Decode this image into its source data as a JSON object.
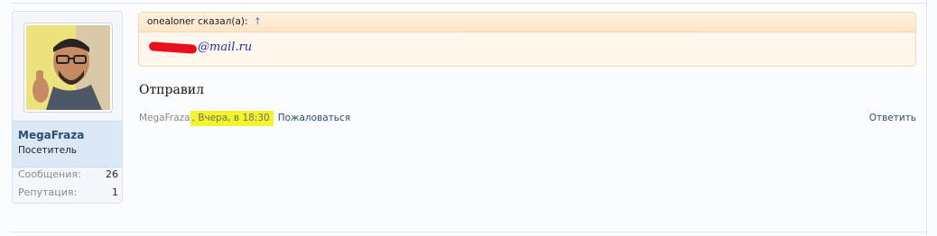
{
  "user": {
    "name": "MegaFraza",
    "title": "Посетитель",
    "stats": [
      {
        "label": "Сообщения:",
        "value": "26"
      },
      {
        "label": "Репутация:",
        "value": "1"
      }
    ]
  },
  "quote": {
    "header": "onealoner сказал(а):",
    "arrow": "↑",
    "email_domain": "@mail.ru"
  },
  "post": {
    "message": "Отправил",
    "author": "MegaFraza",
    "separator": ",",
    "date": "Вчера, в 18:30",
    "report_label": "Пожаловаться",
    "reply_label": "Ответить"
  },
  "colors": {
    "highlight": "#f3f52b",
    "redaction": "#e8101a",
    "link": "#2b4e74"
  }
}
